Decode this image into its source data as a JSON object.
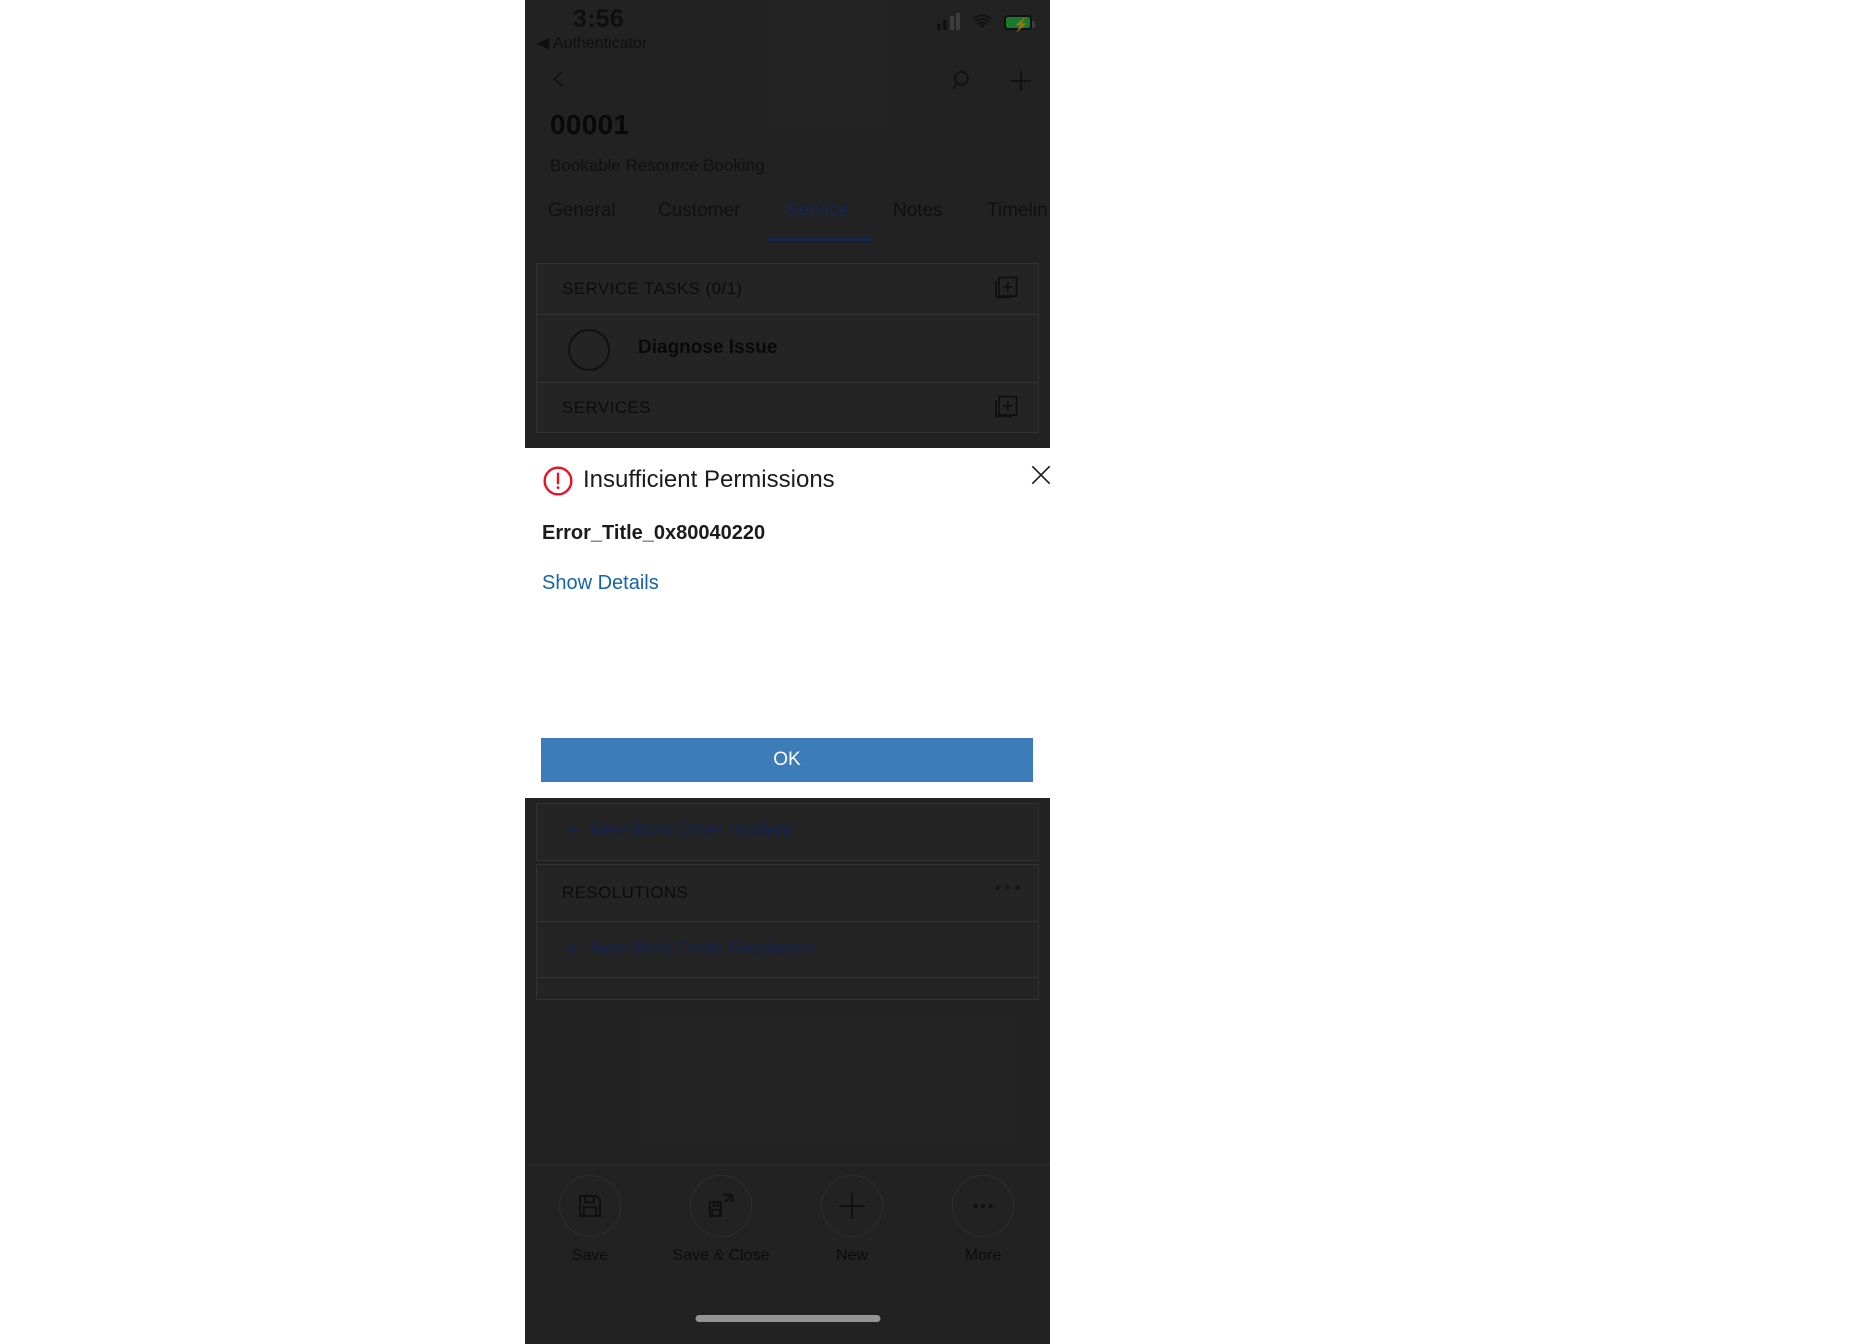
{
  "status_bar": {
    "time": "3:56",
    "back_app": "◀ Authenticator",
    "signal_icon": "cellular-signal-icon",
    "wifi_icon": "wifi-icon",
    "battery_icon": "battery-charging-icon"
  },
  "nav": {
    "back_icon": "chevron-left-icon",
    "search_icon": "search-icon",
    "add_icon": "plus-icon"
  },
  "record": {
    "title": "00001",
    "subtitle": "Bookable Resource Booking"
  },
  "tabs": [
    {
      "label": "General",
      "active": false
    },
    {
      "label": "Customer",
      "active": false
    },
    {
      "label": "Service",
      "active": true
    },
    {
      "label": "Notes",
      "active": false
    },
    {
      "label": "Timelin",
      "active": false
    }
  ],
  "sections": {
    "service_tasks": {
      "header": "SERVICE TASKS (0/1)",
      "add_icon": "add-record-icon",
      "items": [
        {
          "label": "Diagnose Issue",
          "checked": false,
          "checkbox_icon": "circle-checkbox-icon"
        }
      ]
    },
    "services": {
      "header": "SERVICES",
      "add_icon": "add-record-icon"
    },
    "work_order_incidents": {
      "new_link": "New Work Order Incident",
      "plus_icon": "plus-icon"
    },
    "resolutions": {
      "header": "RESOLUTIONS",
      "overflow_icon": "more-horizontal-icon",
      "new_link": "New Work Order Resolution",
      "plus_icon": "plus-icon"
    }
  },
  "command_bar": [
    {
      "label": "Save",
      "icon": "save-floppy-icon"
    },
    {
      "label": "Save & Close",
      "icon": "save-and-close-icon"
    },
    {
      "label": "New",
      "icon": "plus-icon"
    },
    {
      "label": "More",
      "icon": "more-horizontal-icon"
    }
  ],
  "dialog": {
    "title": "Insufficient Permissions",
    "error_icon": "error-exclamation-icon",
    "close_icon": "close-x-icon",
    "error_code": "Error_Title_0x80040220",
    "details_link": "Show Details",
    "ok_label": "OK"
  },
  "colors": {
    "accent_blue": "#3c7cb8",
    "link_blue": "#1565a8",
    "tab_active": "#2b3e8c",
    "error_red": "#e81123",
    "app_background": "#3c3c3c",
    "battery_green": "#2ad24a"
  }
}
